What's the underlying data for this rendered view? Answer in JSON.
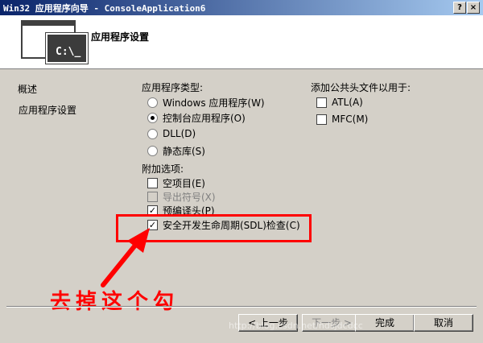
{
  "window": {
    "title": "Win32 应用程序向导 - ConsoleApplication6",
    "help_label": "?",
    "close_label": "×"
  },
  "header": {
    "title": "应用程序设置",
    "prompt": "C:\\_"
  },
  "sidebar": {
    "items": [
      {
        "label": "概述"
      },
      {
        "label": "应用程序设置"
      }
    ]
  },
  "app_type": {
    "label": "应用程序类型:",
    "options": [
      {
        "label": "Windows 应用程序(W)",
        "selected": false
      },
      {
        "label": "控制台应用程序(O)",
        "selected": true
      },
      {
        "label": "DLL(D)",
        "selected": false
      },
      {
        "label": "静态库(S)",
        "selected": false
      }
    ]
  },
  "extra_options": {
    "label": "附加选项:",
    "options": [
      {
        "label": "空项目(E)",
        "checked": false,
        "disabled": false
      },
      {
        "label": "导出符号(X)",
        "checked": false,
        "disabled": true
      },
      {
        "label": "预编译头(P)",
        "checked": true,
        "disabled": false
      },
      {
        "label": "安全开发生命周期(SDL)检查(C)",
        "checked": true,
        "disabled": false
      }
    ]
  },
  "common_headers": {
    "label": "添加公共头文件以用于:",
    "options": [
      {
        "label": "ATL(A)",
        "checked": false
      },
      {
        "label": "MFC(M)",
        "checked": false
      }
    ]
  },
  "buttons": {
    "prev": "< 上一步",
    "next": "下一步 >",
    "finish": "完成",
    "cancel": "取消"
  },
  "annotation": {
    "text": "去掉这个勾",
    "color": "#ff0000"
  },
  "watermark": "http://blog.csdn.net/hdsjdcdcc"
}
